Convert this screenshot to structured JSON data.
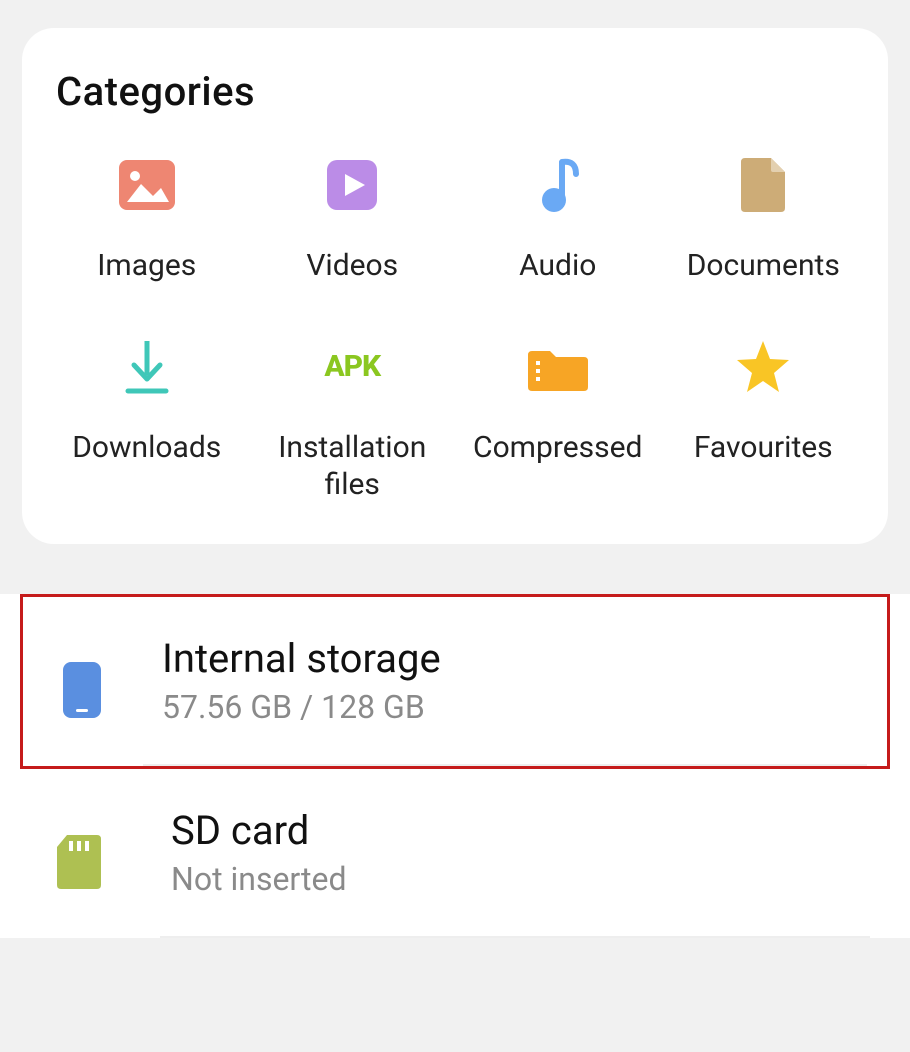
{
  "sections": {
    "categories_title": "Categories"
  },
  "categories": [
    {
      "label": "Images",
      "icon": "images"
    },
    {
      "label": "Videos",
      "icon": "videos"
    },
    {
      "label": "Audio",
      "icon": "audio"
    },
    {
      "label": "Documents",
      "icon": "documents"
    },
    {
      "label": "Downloads",
      "icon": "downloads"
    },
    {
      "label": "Installation files",
      "icon": "apk"
    },
    {
      "label": "Compressed",
      "icon": "compressed"
    },
    {
      "label": "Favourites",
      "icon": "favourites"
    }
  ],
  "storage": {
    "internal": {
      "title": "Internal storage",
      "subtitle": "57.56 GB / 128 GB"
    },
    "sdcard": {
      "title": "SD card",
      "subtitle": "Not inserted"
    }
  }
}
